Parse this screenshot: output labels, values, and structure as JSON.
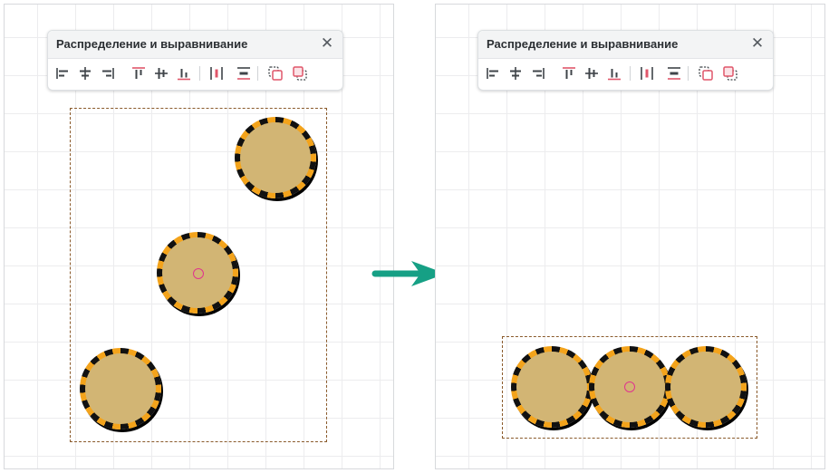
{
  "panel": {
    "title": "Распределение и выравнивание",
    "close_glyph": "✕",
    "tools": [
      {
        "icon": "align-left-icon"
      },
      {
        "icon": "align-center-horizontal-icon"
      },
      {
        "icon": "align-right-icon"
      },
      {
        "icon": "align-top-icon"
      },
      {
        "icon": "align-middle-vertical-icon"
      },
      {
        "icon": "align-bottom-icon"
      },
      {
        "icon": "distribute-horizontal-icon"
      },
      {
        "icon": "distribute-vertical-icon"
      },
      {
        "icon": "bring-forward-icon"
      },
      {
        "icon": "send-backward-icon"
      }
    ]
  },
  "colors": {
    "icon_dark": "#3f4449",
    "icon_accent": "#e0566a",
    "selection": "#8a5a2b",
    "shape_fill": "#d2b574",
    "shape_stripe_a": "#111111",
    "shape_stripe_b": "#f3a31b",
    "center_marker": "#e0348e",
    "arrow": "#16a085"
  }
}
